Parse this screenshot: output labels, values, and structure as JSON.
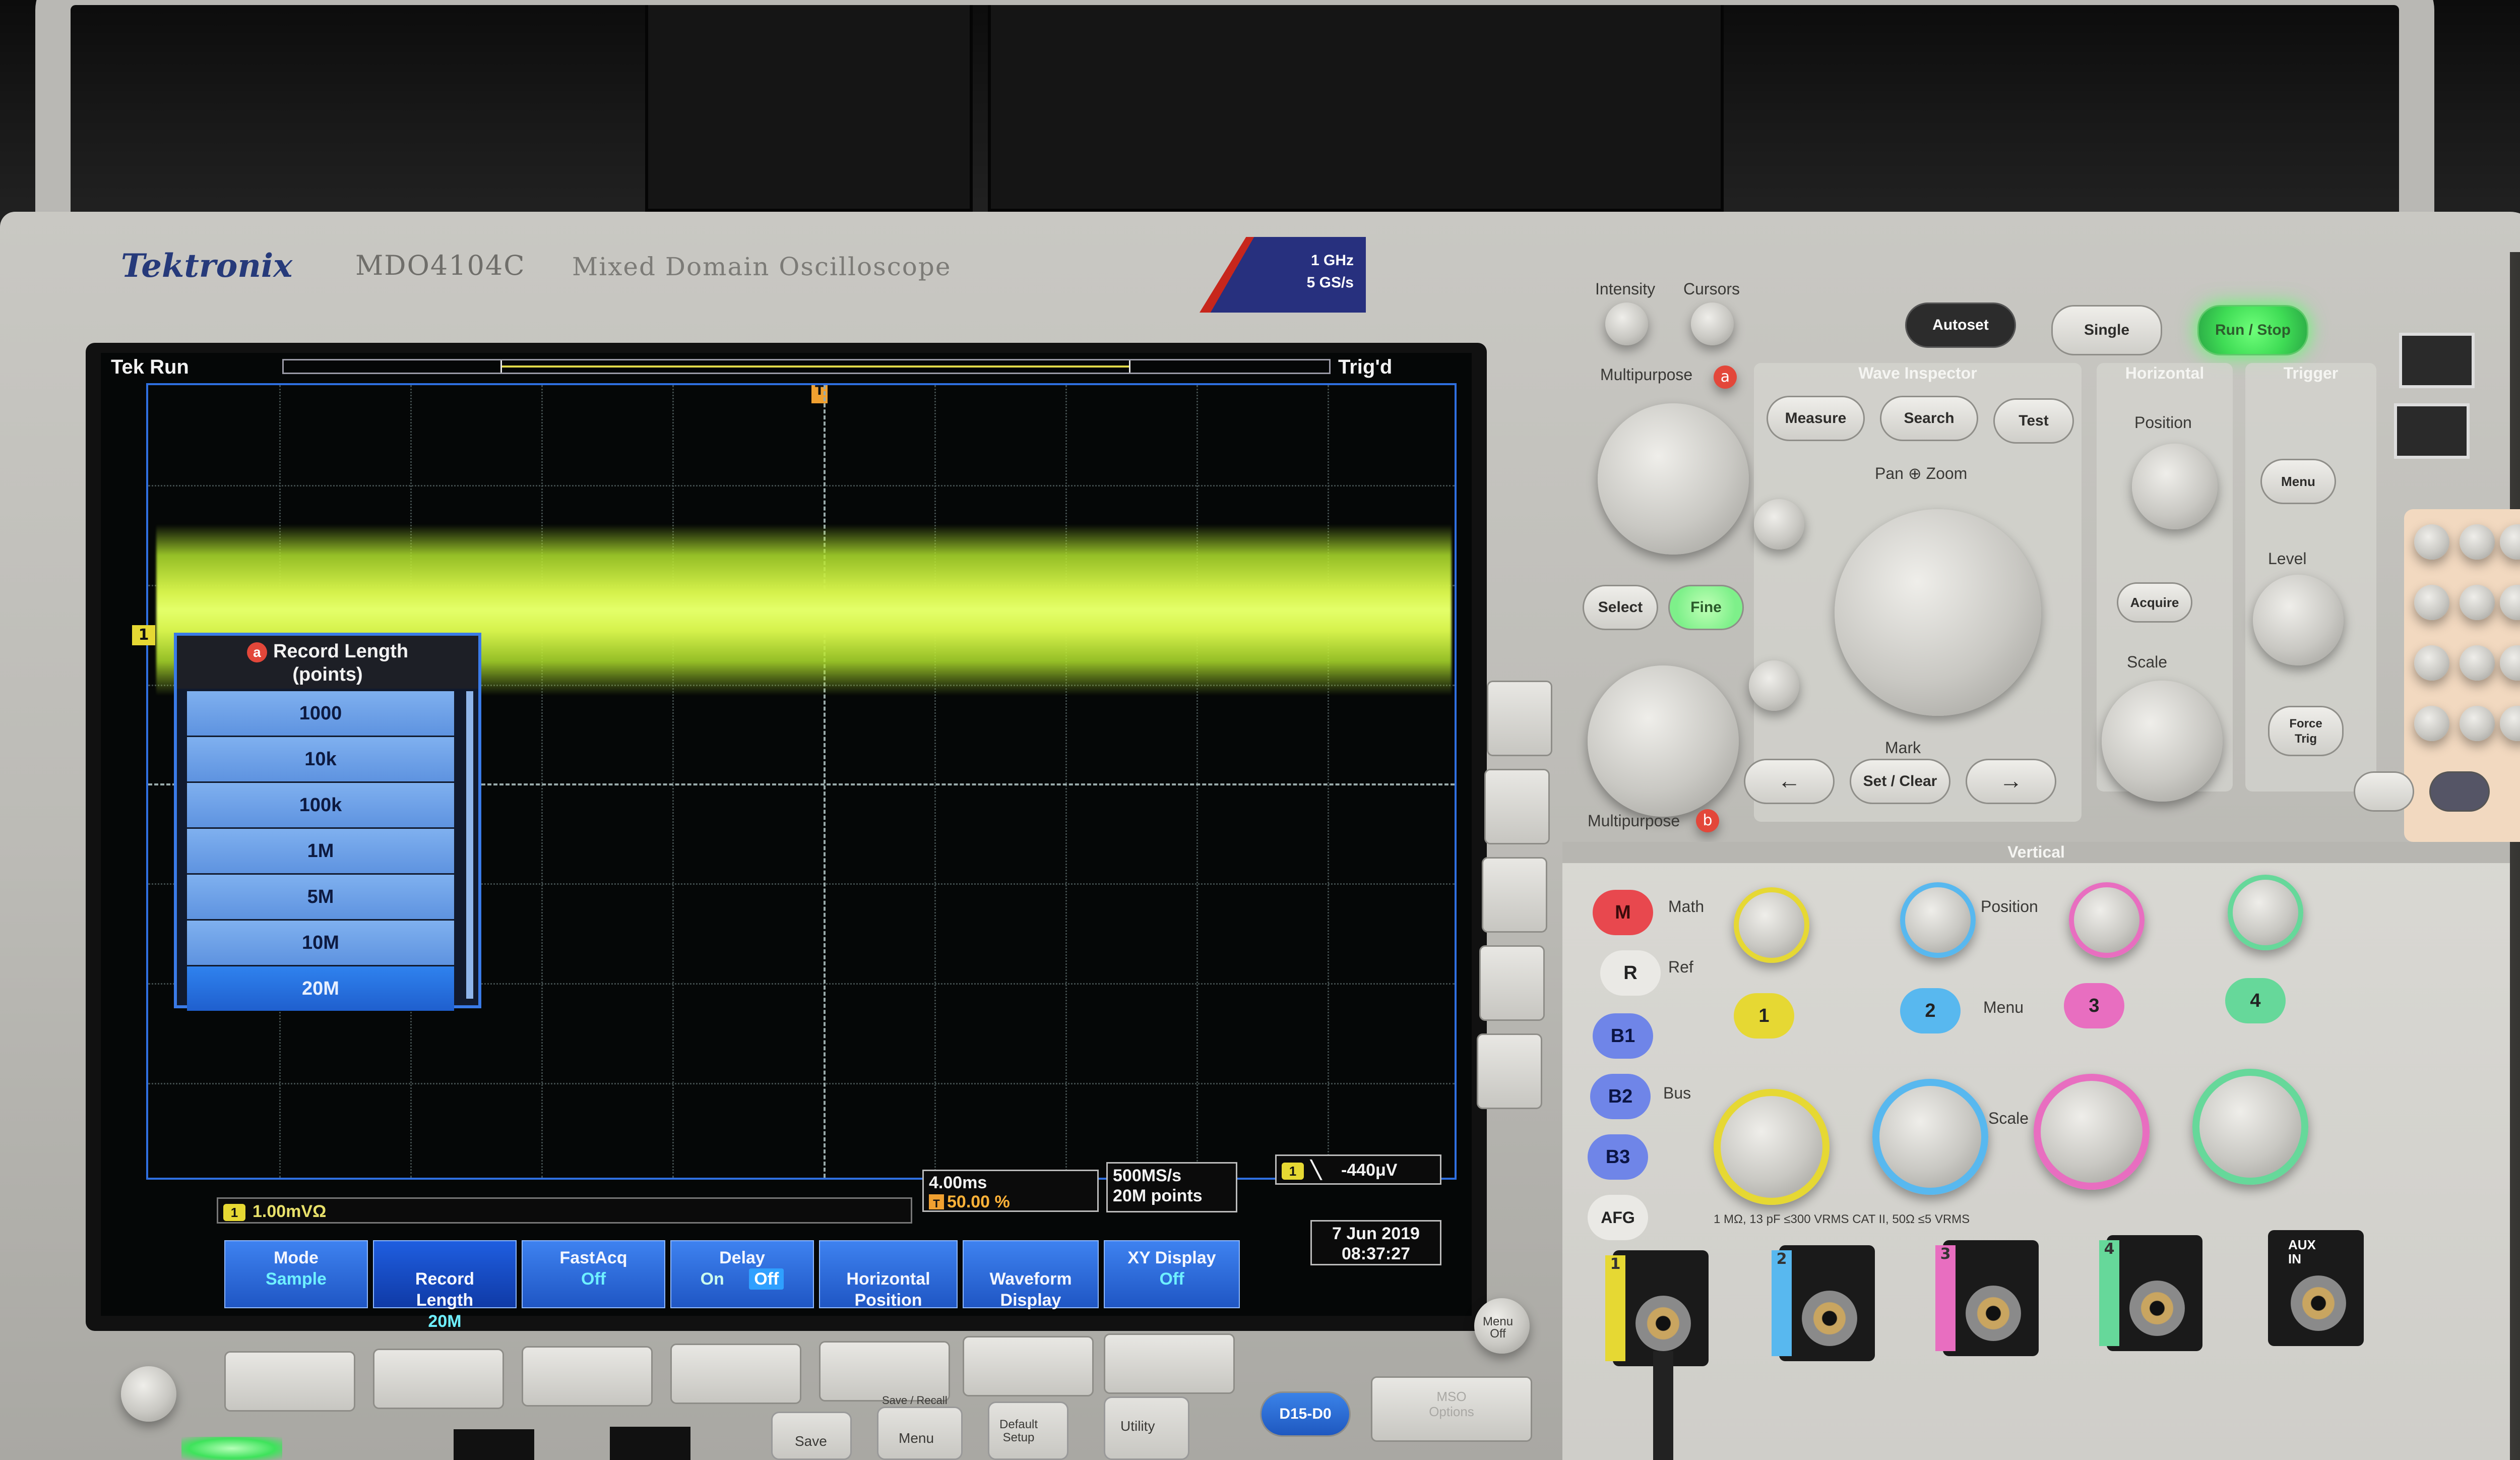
{
  "brand": {
    "name": "Tektronix",
    "model": "MDO4104C",
    "model_name": "Mixed Domain Oscilloscope",
    "bandwidth": "1 GHz",
    "sample_rate_spec": "5 GS/s"
  },
  "screen": {
    "status_left": "Tek Run",
    "status_right": "Trig'd",
    "record_length_popup": {
      "badge": "a",
      "title": "Record Length",
      "subtitle": "(points)",
      "options": [
        "1000",
        "10k",
        "100k",
        "1M",
        "5M",
        "10M",
        "20M"
      ],
      "selected": "20M"
    },
    "channel1_scale": "1.00mVΩ",
    "horizontal": {
      "time_div": "4.00ms",
      "trigger_position": "50.00 %"
    },
    "acquisition": {
      "rate": "500MS/s",
      "points": "20M points"
    },
    "trigger": {
      "slope": "╲",
      "level": "-440μV"
    },
    "datetime": {
      "date": "7 Jun 2019",
      "time": "08:37:27"
    },
    "softkeys": [
      {
        "label": "Mode",
        "value": "Sample"
      },
      {
        "label": "Record\nLength",
        "value": "20M"
      },
      {
        "label": "FastAcq",
        "value": "Off"
      },
      {
        "label": "Delay",
        "value_on": "On",
        "value_off": "Off"
      },
      {
        "label": "Horizontal\nPosition",
        "value": ""
      },
      {
        "label": "Waveform\nDisplay",
        "value": ""
      },
      {
        "label": "XY Display",
        "value": "Off"
      }
    ]
  },
  "panel": {
    "intensity": "Intensity",
    "cursors": "Cursors",
    "autoset": "Autoset",
    "single": "Single",
    "run_stop": "Run / Stop",
    "multipurpose_a": "Multipurpose",
    "multipurpose_b": "Multipurpose",
    "badge_a": "a",
    "badge_b": "b",
    "select": "Select",
    "fine": "Fine",
    "wave_inspector": "Wave Inspector",
    "measure": "Measure",
    "search": "Search",
    "test": "Test",
    "pan_zoom": "Pan ⊕ Zoom",
    "mark": "Mark",
    "set_clear": "Set / Clear",
    "horizontal": "Horizontal",
    "position": "Position",
    "acquire": "Acquire",
    "scale": "Scale",
    "trigger": "Trigger",
    "menu": "Menu",
    "level": "Level",
    "force_trig": "Force\nTrig",
    "vertical": "Vertical",
    "math": "Math",
    "ref": "Ref",
    "bus": "Bus",
    "afg": "AFG",
    "m_key": "M",
    "r_key": "R",
    "b1": "B1",
    "b2": "B2",
    "b3": "B3",
    "channels": [
      "1",
      "2",
      "3",
      "4"
    ],
    "ch_position": "Position",
    "ch_menu": "Menu",
    "ch_scale": "Scale",
    "input_spec": "1 MΩ, 13 pF ≤300 VRMS CAT II, 50Ω ≤5 VRMS",
    "aux_in": "AUX\nIN",
    "menu_off": "Menu\nOff",
    "save_recall": "Save / Recall",
    "save": "Save",
    "menu_btn": "Menu",
    "default_setup": "Default\nSetup",
    "utility": "Utility",
    "d15_d0": "D15-D0",
    "msg_option": "MSO\nOptions"
  },
  "colors": {
    "ch1": "#e6d833",
    "ch2": "#58b8ef",
    "ch3": "#e86ec0",
    "ch4": "#66d89a",
    "trace": "#d6f24c",
    "softkey": "#2f6fe0",
    "brand": "#263a7a",
    "run_stop_led": "#5cff6a"
  }
}
